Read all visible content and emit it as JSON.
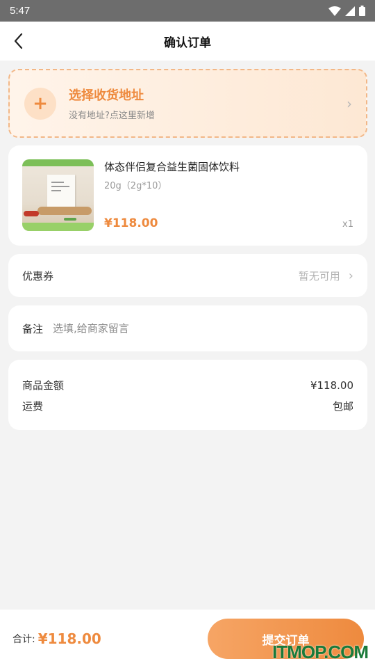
{
  "status_bar": {
    "time": "5:47"
  },
  "header": {
    "title": "确认订单"
  },
  "address": {
    "title": "选择收货地址",
    "subtitle": "没有地址?点这里新增"
  },
  "product": {
    "name": "体态伴侣复合益生菌固体饮料",
    "spec": "20g（2g*10）",
    "price": "¥118.00",
    "quantity": "x1"
  },
  "coupon": {
    "label": "优惠券",
    "value": "暂无可用"
  },
  "remark": {
    "label": "备注",
    "placeholder": "选填,给商家留言"
  },
  "summary": {
    "goods_label": "商品金额",
    "goods_value": "¥118.00",
    "shipping_label": "运费",
    "shipping_value": "包邮"
  },
  "footer": {
    "total_label": "合计:",
    "total_value": "¥118.00",
    "submit_label": "提交订单"
  },
  "watermark": "ITMOP.COM",
  "colors": {
    "accent": "#ee8a3e",
    "background": "#f3f3f3",
    "status_bar": "#6d6d6d"
  }
}
